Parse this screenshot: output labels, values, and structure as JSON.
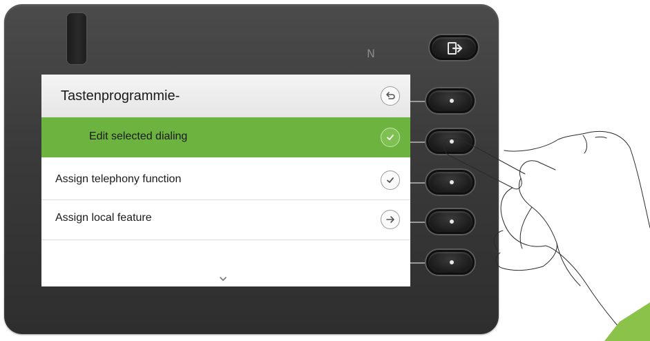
{
  "screen": {
    "title": "Tastenprogrammie-",
    "items": [
      {
        "label": "Edit selected dialing",
        "icon": "check-icon",
        "selected": true
      },
      {
        "label": "Assign telephony function",
        "icon": "check-icon",
        "selected": false
      },
      {
        "label": "Assign local feature",
        "icon": "arrow-right-icon",
        "selected": false
      }
    ],
    "back_icon": "back-arrow-icon",
    "scroll_icon": "chevron-down-icon"
  },
  "hardware": {
    "exit_icon": "exit-icon",
    "nfc_label": "N"
  },
  "colors": {
    "accent_green": "#6db33f",
    "housing": "#3a3a3a"
  }
}
